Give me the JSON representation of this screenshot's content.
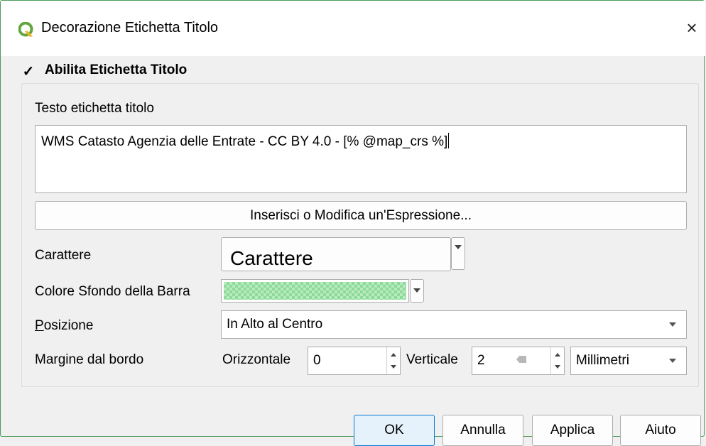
{
  "window": {
    "title": "Decorazione Etichetta Titolo",
    "close_glyph": "×"
  },
  "enable": {
    "checked_glyph": "✓",
    "label": "Abilita Etichetta Titolo"
  },
  "text_section": {
    "label": "Testo etichetta titolo",
    "value": "WMS Catasto Agenzia delle Entrate - CC BY 4.0 - [% @map_crs %]",
    "expression_button": "Inserisci o Modifica un'Espressione..."
  },
  "font": {
    "label": "Carattere",
    "button_text": "Carattere"
  },
  "bar_color": {
    "label": "Colore Sfondo della Barra",
    "color": "#b6ebbd"
  },
  "position": {
    "label_first": "P",
    "label_rest": "osizione",
    "value": "In Alto al Centro"
  },
  "margin": {
    "label": "Margine dal bordo",
    "horizontal_label": "Orizzontale",
    "horizontal_value": "0",
    "vertical_label": "Verticale",
    "vertical_value": "2",
    "unit": "Millimetri"
  },
  "buttons": {
    "ok": "OK",
    "cancel": "Annulla",
    "apply": "Applica",
    "help": "Aiuto"
  },
  "colors": {
    "accent": "#0078d7",
    "window_border": "#4c9a5a"
  }
}
